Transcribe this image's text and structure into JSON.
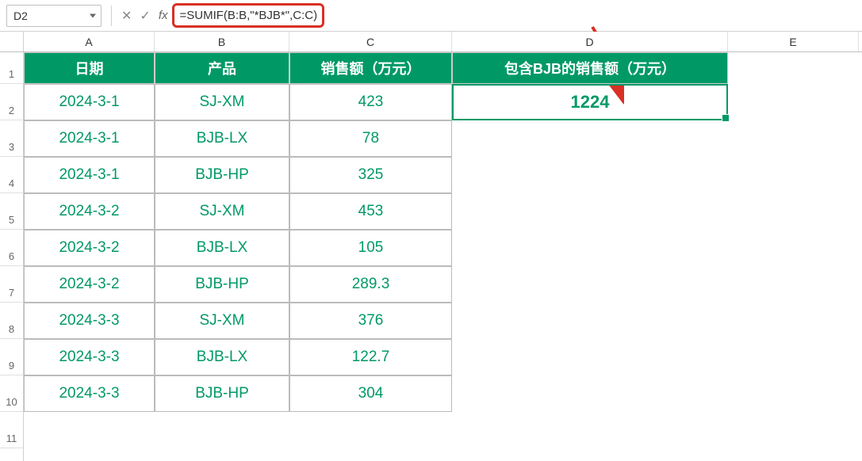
{
  "formula_bar": {
    "cell_ref": "D2",
    "formula": "=SUMIF(B:B,\"*BJB*\",C:C)"
  },
  "columns": {
    "A": "A",
    "B": "B",
    "C": "C",
    "D": "D",
    "E": "E"
  },
  "row_nums": [
    "1",
    "2",
    "3",
    "4",
    "5",
    "6",
    "7",
    "8",
    "9",
    "10",
    "11"
  ],
  "headers": {
    "A": "日期",
    "B": "产品",
    "C": "销售额（万元）",
    "D": "包含BJB的销售额（万元）"
  },
  "rows": [
    {
      "date": "2024-3-1",
      "product": "SJ-XM",
      "sales": "423"
    },
    {
      "date": "2024-3-1",
      "product": "BJB-LX",
      "sales": "78"
    },
    {
      "date": "2024-3-1",
      "product": "BJB-HP",
      "sales": "325"
    },
    {
      "date": "2024-3-2",
      "product": "SJ-XM",
      "sales": "453"
    },
    {
      "date": "2024-3-2",
      "product": "BJB-LX",
      "sales": "105"
    },
    {
      "date": "2024-3-2",
      "product": "BJB-HP",
      "sales": "289.3"
    },
    {
      "date": "2024-3-3",
      "product": "SJ-XM",
      "sales": "376"
    },
    {
      "date": "2024-3-3",
      "product": "BJB-LX",
      "sales": "122.7"
    },
    {
      "date": "2024-3-3",
      "product": "BJB-HP",
      "sales": "304"
    }
  ],
  "result": "1224",
  "chart_data": {
    "type": "table",
    "title": "销售额（万元）",
    "columns": [
      "日期",
      "产品",
      "销售额（万元）"
    ],
    "data": [
      [
        "2024-3-1",
        "SJ-XM",
        423
      ],
      [
        "2024-3-1",
        "BJB-LX",
        78
      ],
      [
        "2024-3-1",
        "BJB-HP",
        325
      ],
      [
        "2024-3-2",
        "SJ-XM",
        453
      ],
      [
        "2024-3-2",
        "BJB-LX",
        105
      ],
      [
        "2024-3-2",
        "BJB-HP",
        289.3
      ],
      [
        "2024-3-3",
        "SJ-XM",
        376
      ],
      [
        "2024-3-3",
        "BJB-LX",
        122.7
      ],
      [
        "2024-3-3",
        "BJB-HP",
        304
      ]
    ],
    "summary": {
      "label": "包含BJB的销售额（万元）",
      "value": 1224,
      "formula": "=SUMIF(B:B,\"*BJB*\",C:C)"
    }
  }
}
